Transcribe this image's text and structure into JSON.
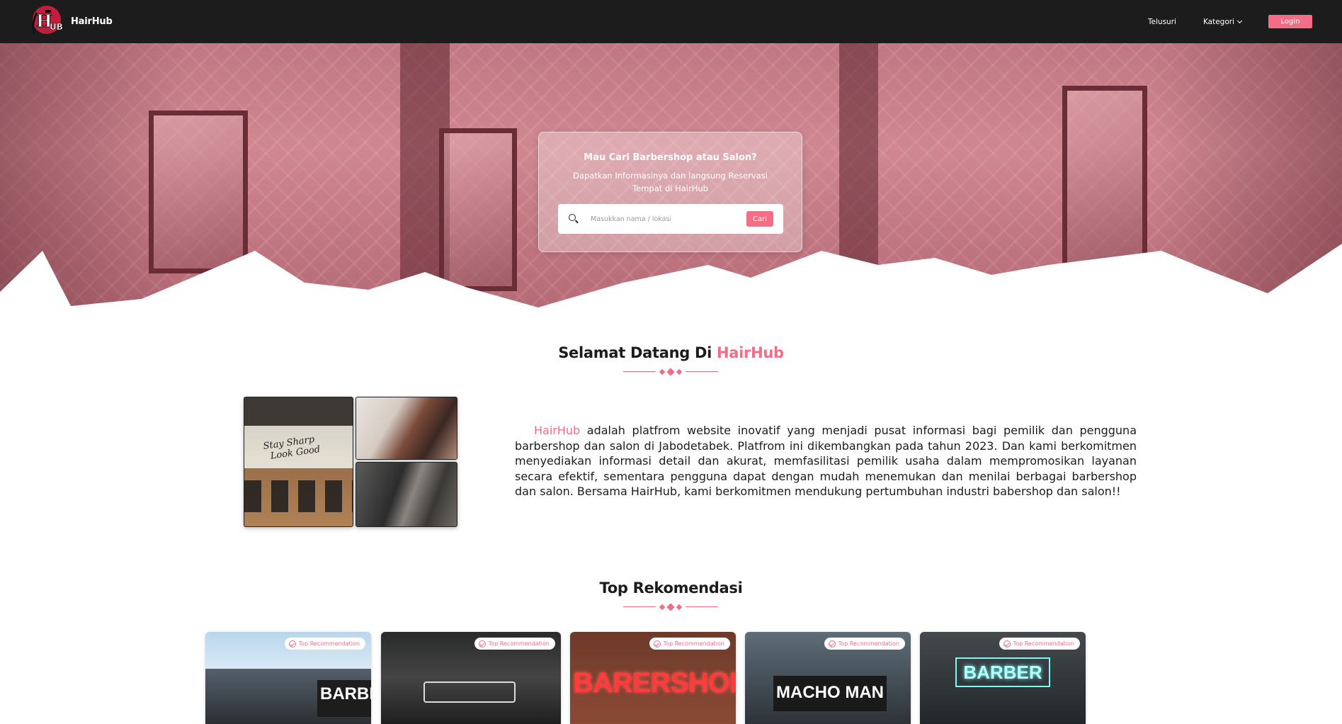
{
  "navbar": {
    "brand_name": "HairHub",
    "links": [
      {
        "label": "Telusuri"
      },
      {
        "label": "Kategori"
      }
    ],
    "login_label": "Login"
  },
  "hero": {
    "title": "Mau Cari Barbershop atau Salon?",
    "subtitle": "Dapatkan Informasinya dan langsung Reservasi Tempat di HairHub",
    "search_placeholder": "Masukkan nama / lokasi",
    "search_button": "Cari"
  },
  "welcome": {
    "title_prefix": "Selamat Datang Di ",
    "title_accent": "HairHub",
    "about_accent": "HairHub",
    "about_text": " adalah platfrom website inovatif yang menjadi pusat informasi bagi pemilik dan pengguna barbershop dan salon di Jabodetabek. Platfrom ini dikembangkan pada tahun 2023. Dan kami berkomitmen menyediakan informasi detail dan akurat, memfasilitasi pemilik usaha dalam mempromosikan layanan secara efektif, sementara pengguna dapat dengan mudah menemukan dan menilai berbagai barbershop dan salon. Bersama HairHub, kami berkomitmen mendukung pertumbuhan industri babershop dan salon!!"
  },
  "recommendations": {
    "title": "Top Rekomendasi",
    "badge_label": "Top Recommendation",
    "cards": [
      {
        "sign": "BARBER"
      },
      {
        "sign": ""
      },
      {
        "sign": "BARERSHOP"
      },
      {
        "sign": "MACHO MAN"
      },
      {
        "sign": "BARBER"
      }
    ]
  },
  "colors": {
    "accent": "#f26d85",
    "navbar": "#1c1c1c"
  }
}
